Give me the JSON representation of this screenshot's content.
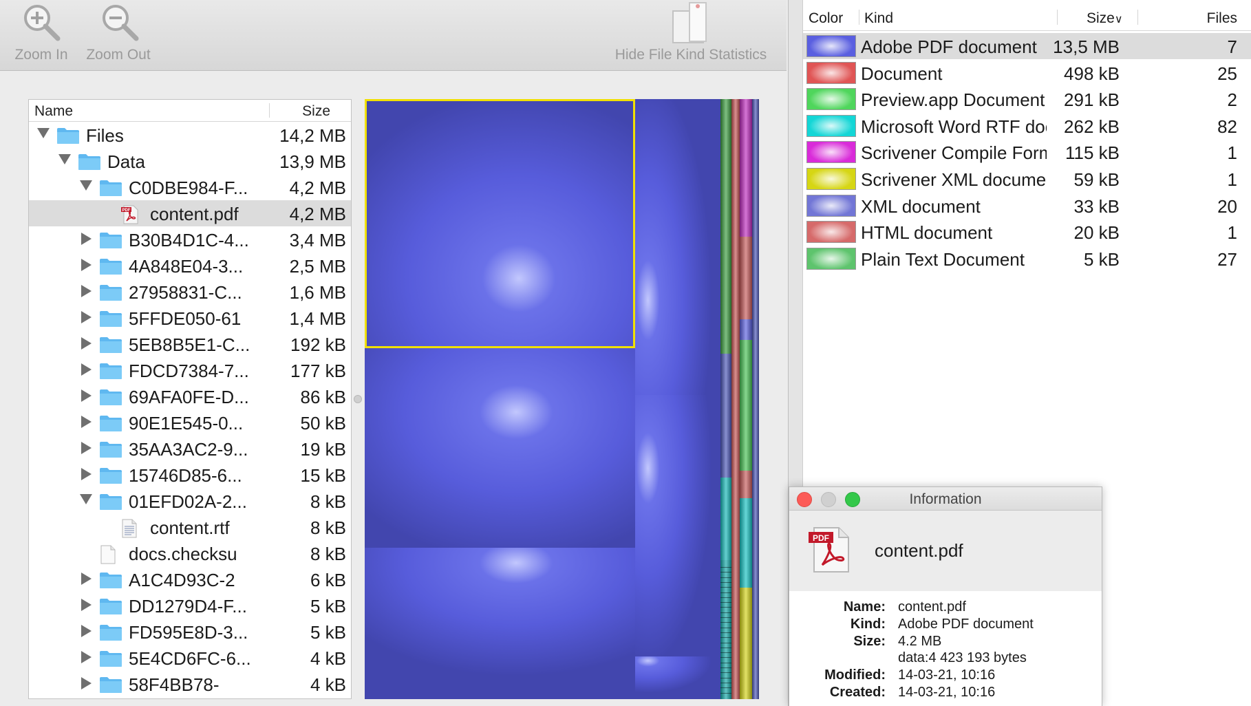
{
  "toolbar": {
    "zoom_in": "Zoom In",
    "zoom_out": "Zoom Out",
    "hide_stats": "Hide File Kind Statistics"
  },
  "tree": {
    "col_name": "Name",
    "col_size": "Size",
    "rows": [
      {
        "name": "Files",
        "size": "14,2 MB",
        "level": 0,
        "toggle": "open",
        "icon": "folder-icon"
      },
      {
        "name": "Data",
        "size": "13,9 MB",
        "level": 1,
        "toggle": "open",
        "icon": "folder-icon"
      },
      {
        "name": "C0DBE984-F...",
        "size": "4,2 MB",
        "level": 2,
        "toggle": "open",
        "icon": "folder-icon"
      },
      {
        "name": "content.pdf",
        "size": "4,2 MB",
        "level": 3,
        "toggle": "none",
        "icon": "pdf-file-icon",
        "selected": true
      },
      {
        "name": "B30B4D1C-4...",
        "size": "3,4 MB",
        "level": 2,
        "toggle": "closed",
        "icon": "folder-icon"
      },
      {
        "name": "4A848E04-3...",
        "size": "2,5 MB",
        "level": 2,
        "toggle": "closed",
        "icon": "folder-icon"
      },
      {
        "name": "27958831-C...",
        "size": "1,6 MB",
        "level": 2,
        "toggle": "closed",
        "icon": "folder-icon"
      },
      {
        "name": "5FFDE050-61",
        "size": "1,4 MB",
        "level": 2,
        "toggle": "closed",
        "icon": "folder-icon"
      },
      {
        "name": "5EB8B5E1-C...",
        "size": "192 kB",
        "level": 2,
        "toggle": "closed",
        "icon": "folder-icon"
      },
      {
        "name": "FDCD7384-7...",
        "size": "177 kB",
        "level": 2,
        "toggle": "closed",
        "icon": "folder-icon"
      },
      {
        "name": "69AFA0FE-D...",
        "size": "86 kB",
        "level": 2,
        "toggle": "closed",
        "icon": "folder-icon"
      },
      {
        "name": "90E1E545-0...",
        "size": "50 kB",
        "level": 2,
        "toggle": "closed",
        "icon": "folder-icon"
      },
      {
        "name": "35AA3AC2-9...",
        "size": "19 kB",
        "level": 2,
        "toggle": "closed",
        "icon": "folder-icon"
      },
      {
        "name": "15746D85-6...",
        "size": "15 kB",
        "level": 2,
        "toggle": "closed",
        "icon": "folder-icon"
      },
      {
        "name": "01EFD02A-2...",
        "size": "8 kB",
        "level": 2,
        "toggle": "open",
        "icon": "folder-icon"
      },
      {
        "name": "content.rtf",
        "size": "8 kB",
        "level": 3,
        "toggle": "none",
        "icon": "text-file-icon"
      },
      {
        "name": "docs.checksu",
        "size": "8 kB",
        "level": 2,
        "toggle": "none",
        "icon": "blank-file-icon"
      },
      {
        "name": "A1C4D93C-2",
        "size": "6 kB",
        "level": 2,
        "toggle": "closed",
        "icon": "folder-icon"
      },
      {
        "name": "DD1279D4-F...",
        "size": "5 kB",
        "level": 2,
        "toggle": "closed",
        "icon": "folder-icon"
      },
      {
        "name": "FD595E8D-3...",
        "size": "5 kB",
        "level": 2,
        "toggle": "closed",
        "icon": "folder-icon"
      },
      {
        "name": "5E4CD6FC-6...",
        "size": "4 kB",
        "level": 2,
        "toggle": "closed",
        "icon": "folder-icon"
      },
      {
        "name": "58F4BB78-",
        "size": "4 kB",
        "level": 2,
        "toggle": "closed",
        "icon": "folder-icon"
      }
    ]
  },
  "stats": {
    "col_color": "Color",
    "col_kind": "Kind",
    "col_size": "Size",
    "col_files": "Files",
    "rows": [
      {
        "kind": "Adobe PDF document",
        "size": "13,5 MB",
        "files": "7",
        "color": "#5a5fe0",
        "selected": true
      },
      {
        "kind": "Document",
        "size": "498 kB",
        "files": "25",
        "color": "#e05555"
      },
      {
        "kind": "Preview.app Document",
        "size": "291 kB",
        "files": "2",
        "color": "#4fd65c"
      },
      {
        "kind": "Microsoft Word RTF document",
        "size": "262 kB",
        "files": "82",
        "color": "#14d6d6"
      },
      {
        "kind": "Scrivener Compile Format",
        "size": "115 kB",
        "files": "1",
        "color": "#d92bd9"
      },
      {
        "kind": "Scrivener XML document",
        "size": "59 kB",
        "files": "1",
        "color": "#d6d614"
      },
      {
        "kind": "XML document",
        "size": "33 kB",
        "files": "20",
        "color": "#7276d6"
      },
      {
        "kind": "HTML document",
        "size": "20 kB",
        "files": "1",
        "color": "#d66a6a"
      },
      {
        "kind": "Plain Text Document",
        "size": "5 kB",
        "files": "27",
        "color": "#5ec46d"
      }
    ]
  },
  "info": {
    "title": "Information",
    "filename": "content.pdf",
    "pdf_badge": "PDF",
    "labels": {
      "name": "Name:",
      "kind": "Kind:",
      "size": "Size:",
      "modified": "Modified:",
      "created": "Created:"
    },
    "values": {
      "name": "content.pdf",
      "kind": "Adobe PDF document",
      "size": "4.2 MB",
      "size_bytes": "data:4 423 193 bytes",
      "modified": "14-03-21, 10:16",
      "created": "14-03-21, 10:16"
    }
  },
  "colors": {
    "pdf": "#5a5fe0",
    "selection_outline": "#f0e000",
    "folder": "#6ec3f4"
  }
}
